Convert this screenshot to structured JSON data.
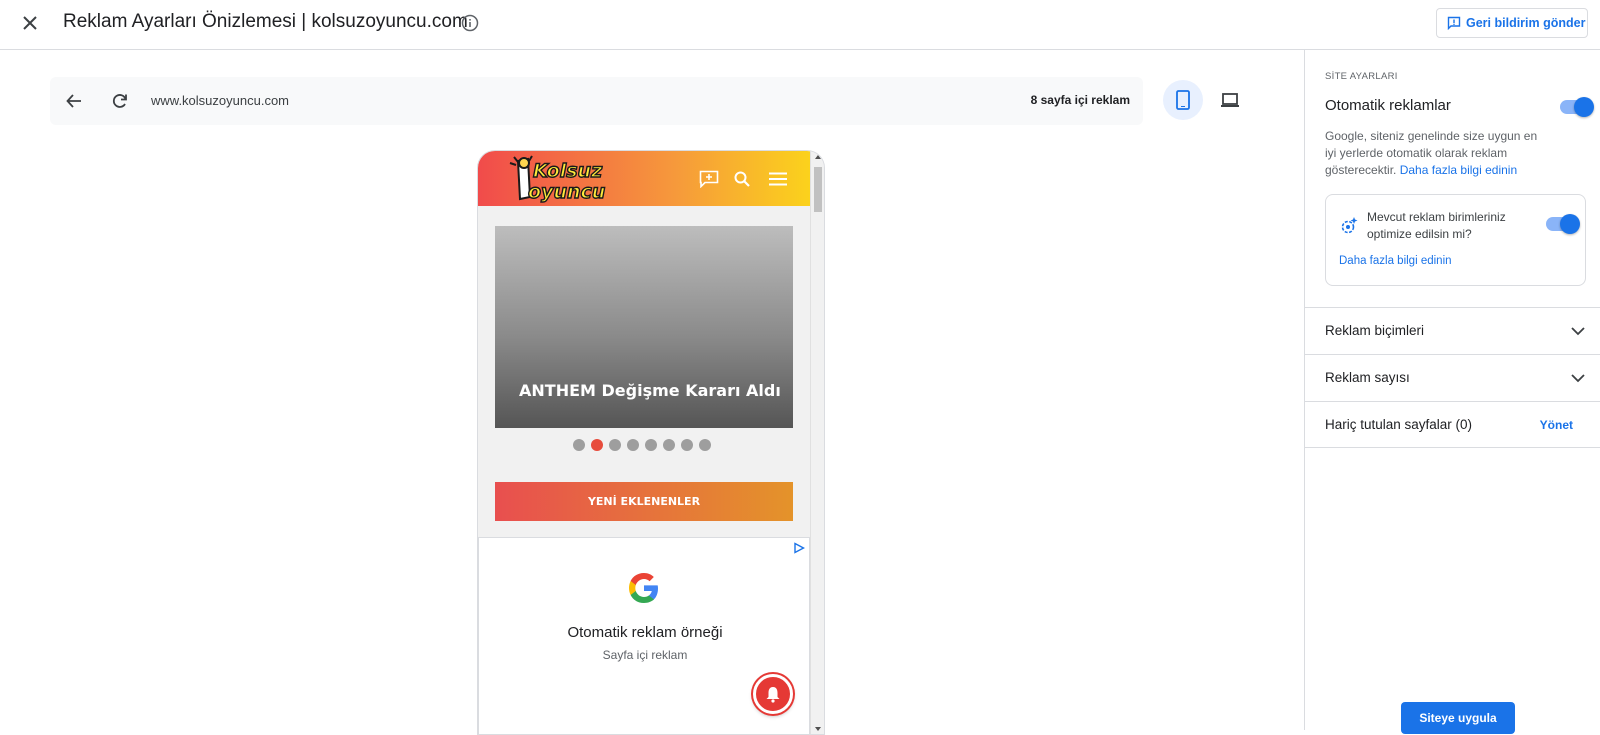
{
  "header": {
    "title": "Reklam Ayarları Önizlemesi | kolsuzoyuncu.com",
    "feedback_label": "Geri bildirim gönder"
  },
  "preview": {
    "url": "www.kolsuzoyuncu.com",
    "ad_count": "8 sayfa içi reklam",
    "selected_device": "mobile"
  },
  "site": {
    "logo_text": "Kolsuz oyuncu",
    "slide_title": "ANTHEM Değişme Kararı Aldı",
    "slide_count": 8,
    "active_slide": 2,
    "new_button": "YENİ EKLENENLER",
    "ad_title": "Otomatik reklam örneği",
    "ad_subtitle": "Sayfa içi reklam"
  },
  "sidebar": {
    "heading": "SİTE AYARLARI",
    "auto_ads_label": "Otomatik reklamlar",
    "auto_ads_enabled": true,
    "auto_ads_desc": "Google, siteniz genelinde size uygun en iyi yerlerde otomatik olarak reklam gösterecektir.",
    "learn_more": "Daha fazla bilgi edinin",
    "optimize_label": "Mevcut reklam birimleriniz optimize edilsin mi?",
    "optimize_enabled": true,
    "optimize_link": "Daha fazla bilgi edinin",
    "ad_formats": "Reklam biçimleri",
    "ad_load": "Reklam sayısı",
    "excluded_pages": "Hariç tutulan sayfalar (0)",
    "manage": "Yönet",
    "apply": "Siteye uygula"
  },
  "colors": {
    "accent": "#1a73e8",
    "header_gradient_start": "#f14b4b",
    "header_gradient_end": "#fbd21c",
    "active_dot": "#e74c3c"
  }
}
